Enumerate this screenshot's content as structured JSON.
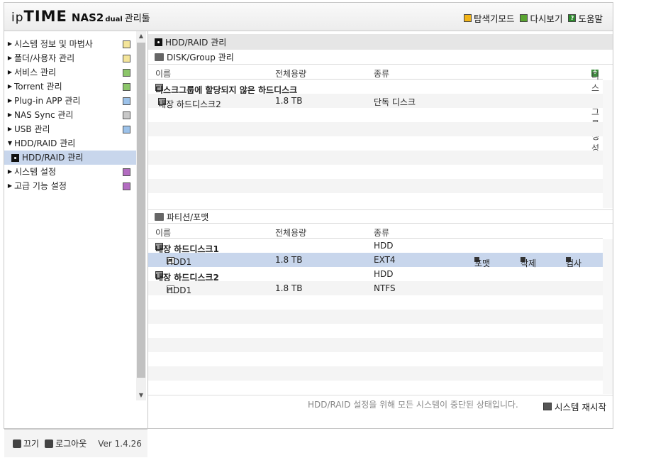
{
  "header": {
    "logo_ip": "ip",
    "logo_time": "TIME",
    "logo_nas": "NAS2",
    "logo_dual": "dual",
    "logo_tool": "관리툴",
    "links": {
      "explorer": "탐색기모드",
      "refresh": "다시보기",
      "help": "도움말"
    }
  },
  "sidebar": {
    "items": [
      {
        "label": "시스템 정보 및 마법사",
        "icon": "chart-icon"
      },
      {
        "label": "폴더/사용자 관리",
        "icon": "folder-icon"
      },
      {
        "label": "서비스 관리",
        "icon": "service-icon"
      },
      {
        "label": "Torrent 관리",
        "icon": "torrent-icon"
      },
      {
        "label": "Plug-in APP 관리",
        "icon": "plugin-icon"
      },
      {
        "label": "NAS Sync 관리",
        "icon": "sync-icon"
      },
      {
        "label": "USB 관리",
        "icon": "usb-icon"
      },
      {
        "label": "HDD/RAID 관리"
      },
      {
        "label": "시스템 설정",
        "icon": "settings-icon"
      },
      {
        "label": "고급 기능 설정",
        "icon": "advanced-icon"
      }
    ],
    "sub_item": "HDD/RAID 관리",
    "footer": {
      "power": "끄기",
      "logout": "로그아웃",
      "version": "Ver 1.4.26"
    }
  },
  "main": {
    "page_title": "HDD/RAID 관리",
    "disk_group": {
      "title": "DISK/Group 관리",
      "columns": [
        "이름",
        "전체용량",
        "종류"
      ],
      "create_button": "디스크그룹 생성",
      "unassigned_label": "디스크그룹에 할당되지 않은 하드디스크",
      "rows": [
        {
          "name": "내장 하드디스크2",
          "capacity": "1.8 TB",
          "type": "단독 디스크"
        }
      ]
    },
    "partition": {
      "title": "파티션/포맷",
      "columns": [
        "이름",
        "전체용량",
        "종류"
      ],
      "disk1": {
        "name": "내장 하드디스크1",
        "type": "HDD"
      },
      "disk1_hdd": {
        "name": "HDD1",
        "capacity": "1.8 TB",
        "type": "EXT4"
      },
      "actions": {
        "format": "포맷",
        "delete": "삭제",
        "check": "검사"
      },
      "disk2": {
        "name": "내장 하드디스크2",
        "type": "HDD"
      },
      "disk2_hdd": {
        "name": "HDD1",
        "capacity": "1.8 TB",
        "type": "NTFS"
      }
    },
    "footer": {
      "notice": "HDD/RAID 설정을 위해 모든 시스템이 중단된 상태입니다.",
      "restart": "시스템 재시작"
    }
  }
}
